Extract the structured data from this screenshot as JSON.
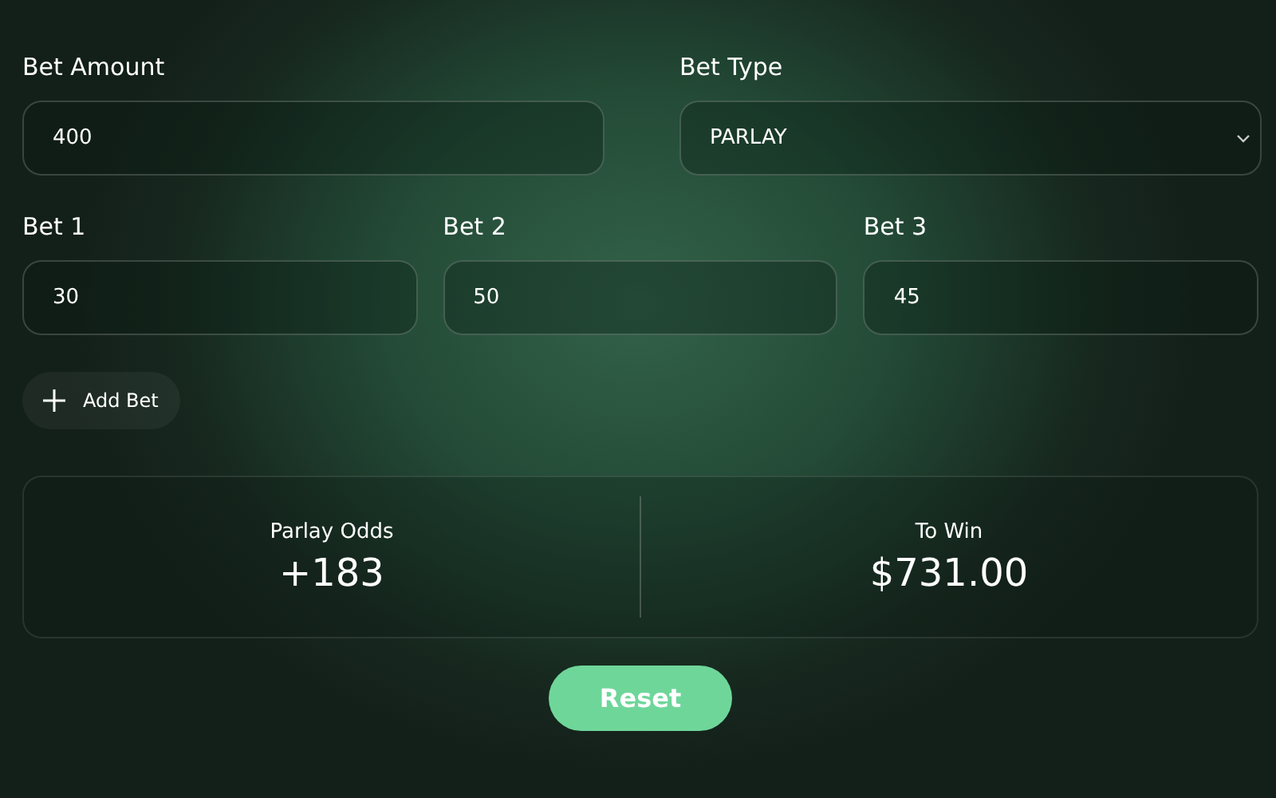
{
  "bet_amount": {
    "label": "Bet Amount",
    "value": "400"
  },
  "bet_type": {
    "label": "Bet Type",
    "value": "PARLAY"
  },
  "bets": [
    {
      "label": "Bet 1",
      "value": "30"
    },
    {
      "label": "Bet 2",
      "value": "50"
    },
    {
      "label": "Bet 3",
      "value": "45"
    }
  ],
  "add_bet": {
    "label": "Add Bet"
  },
  "results": [
    {
      "label": "Parlay Odds",
      "value": "+183"
    },
    {
      "label": "To Win",
      "value": "$731.00"
    }
  ],
  "reset": {
    "label": "Reset"
  }
}
